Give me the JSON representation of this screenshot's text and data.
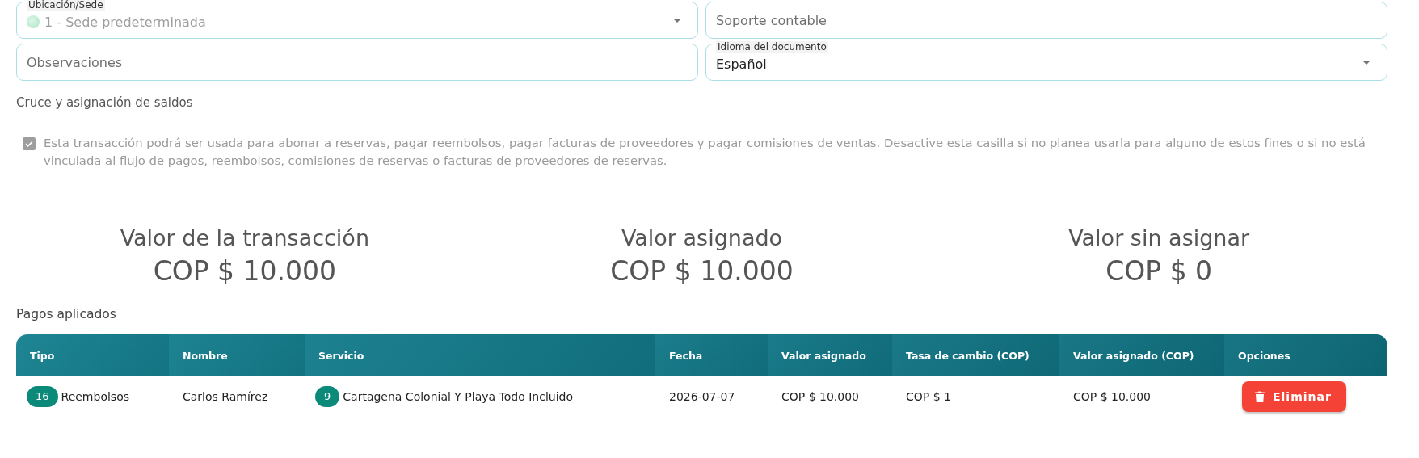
{
  "fields": [
    {
      "kind": "select",
      "label": "Ubicación/Sede",
      "placeholder": "1 - Sede predeterminada"
    },
    {
      "kind": "text",
      "placeholder": "Soporte contable"
    },
    {
      "kind": "text",
      "placeholder": "Observaciones"
    },
    {
      "kind": "select",
      "label": "Idioma del documento",
      "value": "Español"
    }
  ],
  "crossing": {
    "title": "Cruce y asignación de saldos",
    "checkbox": {
      "label": "Esta transacción podrá ser usada para abonar a reservas, pagar reembolsos, pagar facturas de proveedores y pagar comisiones de ventas. Desactive esta casilla si no planea usarla para alguno de estos fines o si no está vinculada al flujo de pagos, reembolsos, comisiones de reservas o facturas de proveedores de reservas.",
      "checked": true,
      "disabled": true
    }
  },
  "summary": [
    {
      "label": "Valor de la transacción",
      "value": "COP $ 10.000"
    },
    {
      "label": "Valor asignado",
      "value": "COP $ 10.000"
    },
    {
      "label": "Valor sin asignar",
      "value": "COP $ 0"
    }
  ],
  "payments": {
    "title": "Pagos aplicados",
    "columns": [
      "Tipo",
      "Nombre",
      "Servicio",
      "Fecha",
      "Valor asignado",
      "Tasa de cambio (COP)",
      "Valor asignado (COP)",
      "Opciones"
    ],
    "rows": [
      {
        "tipo": {
          "badge": "16",
          "text": "Reembolsos"
        },
        "nombre": "Carlos Ramírez",
        "servicio": {
          "badge": "9",
          "text": "Cartagena Colonial Y Playa Todo Incluido"
        },
        "fecha": "2026-07-07",
        "valor_asignado": "COP $ 10.000",
        "tasa": "COP $ 1",
        "valor_cop": "COP $ 10.000",
        "action": "Eliminar"
      }
    ]
  }
}
